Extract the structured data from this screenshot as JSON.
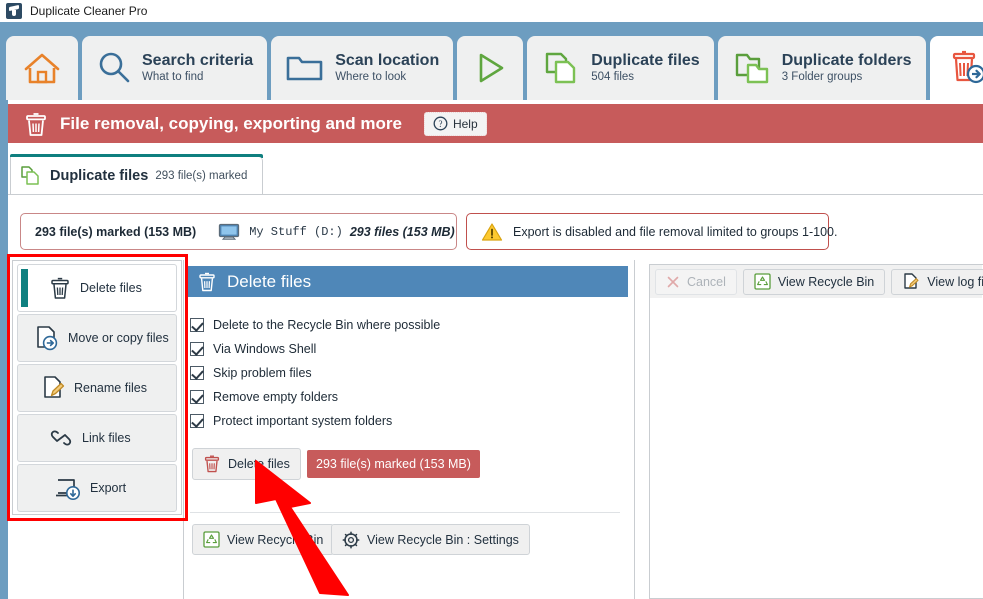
{
  "window": {
    "title": "Duplicate Cleaner Pro",
    "app_icon": "broom-icon"
  },
  "ribbon": {
    "tabs": [
      {
        "id": "home",
        "icon": "home-icon",
        "main": "",
        "sub": "",
        "icon_only": true,
        "active": false
      },
      {
        "id": "search-criteria",
        "icon": "magnifier-icon",
        "main": "Search criteria",
        "sub": "What to find",
        "icon_only": false,
        "active": false
      },
      {
        "id": "scan-location",
        "icon": "folder-icon",
        "main": "Scan location",
        "sub": "Where to look",
        "icon_only": false,
        "active": false
      },
      {
        "id": "scan-go",
        "icon": "play-icon",
        "main": "",
        "sub": "",
        "icon_only": true,
        "active": false
      },
      {
        "id": "duplicate-files",
        "icon": "duplicate-files-icon",
        "main": "Duplicate files",
        "sub": "504 files",
        "icon_only": false,
        "active": false
      },
      {
        "id": "duplicate-folders",
        "icon": "duplicate-folders-icon",
        "main": "Duplicate folders",
        "sub": "3 Folder groups",
        "icon_only": false,
        "active": false
      },
      {
        "id": "file-removal",
        "icon": "trash-arrow-icon",
        "main": "",
        "sub": "",
        "icon_only": true,
        "active": true
      },
      {
        "id": "toolbox",
        "icon": "briefcase-icon",
        "main": "",
        "sub": "",
        "icon_only": true,
        "active": false
      }
    ]
  },
  "banner": {
    "icon": "trash-icon",
    "title": "File removal, copying, exporting and more",
    "help_label": "Help",
    "help_icon": "question-circle-icon",
    "color": "#c75b5b"
  },
  "subtab": {
    "icon": "duplicate-files-icon",
    "title": "Duplicate files",
    "subtitle": "293 file(s) marked",
    "accent": "#0f7f7f"
  },
  "summary": {
    "marked_count": "293 file(s) marked (153 MB)",
    "monitor_icon": "monitor-icon",
    "drive_label": "My Stuff (D:)",
    "drive_files": "293 files (153 MB)",
    "warning_icon": "warning-triangle-icon",
    "warning_text": "Export is disabled and file removal limited to groups 1-100."
  },
  "actions": [
    {
      "id": "delete-files",
      "label": "Delete files",
      "icon": "trash-icon",
      "selected": true
    },
    {
      "id": "move-or-copy-files",
      "label": "Move or copy files",
      "icon": "file-arrow-icon",
      "selected": false
    },
    {
      "id": "rename-files",
      "label": "Rename files",
      "icon": "file-pencil-icon",
      "selected": false
    },
    {
      "id": "link-files",
      "label": "Link files",
      "icon": "link-icon",
      "selected": false
    },
    {
      "id": "export",
      "label": "Export",
      "icon": "export-icon",
      "selected": false
    }
  ],
  "panel": {
    "icon": "trash-icon",
    "title": "Delete files",
    "header_color": "#4f87b8",
    "options": [
      {
        "id": "delete-to-recycle-bin",
        "label": "Delete to the Recycle Bin where possible",
        "checked": true
      },
      {
        "id": "via-windows-shell",
        "label": "Via Windows Shell",
        "checked": true
      },
      {
        "id": "skip-problem-files",
        "label": "Skip problem files",
        "checked": true
      },
      {
        "id": "remove-empty-folders",
        "label": "Remove empty folders",
        "checked": true
      },
      {
        "id": "protect-important-system-folders",
        "label": "Protect important system folders",
        "checked": true
      }
    ],
    "delete_button": {
      "label": "Delete files",
      "icon": "trash-icon"
    },
    "marked_badge": "293 file(s) marked (153 MB)",
    "view_recycle_bin": {
      "label": "View Recycle Bin",
      "icon": "recycle-icon"
    },
    "view_recycle_bin_settings": {
      "label": "View Recycle Bin : Settings",
      "icon": "gear-icon"
    }
  },
  "right_panel": {
    "buttons": [
      {
        "id": "cancel",
        "label": "Cancel",
        "icon": "close-x-icon",
        "disabled": true
      },
      {
        "id": "view-recycle-bin",
        "label": "View Recycle Bin",
        "icon": "recycle-icon",
        "disabled": false
      },
      {
        "id": "view-log-file",
        "label": "View log file",
        "icon": "file-pencil-icon",
        "disabled": false
      }
    ]
  },
  "annotations": {
    "highlight_color": "#ff0000",
    "arrow_color": "#ff0000"
  }
}
